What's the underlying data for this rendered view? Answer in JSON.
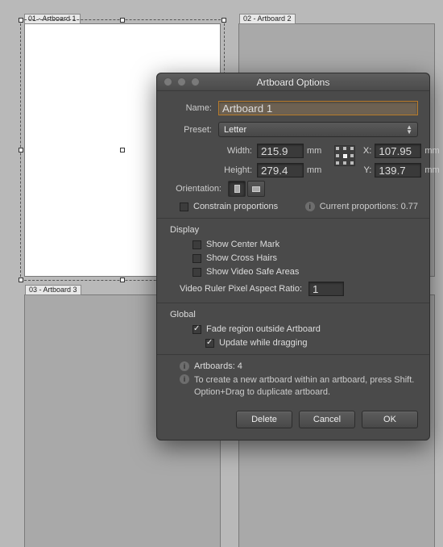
{
  "artboards": [
    {
      "label": "01 - Artboard 1"
    },
    {
      "label": "02 - Artboard 2"
    },
    {
      "label": "03 - Artboard 3"
    }
  ],
  "dialog": {
    "title": "Artboard Options",
    "name_label": "Name:",
    "name_value": "Artboard 1",
    "preset_label": "Preset:",
    "preset_value": "Letter",
    "width_label": "Width:",
    "width_value": "215.9",
    "width_unit": "mm",
    "height_label": "Height:",
    "height_value": "279.4",
    "height_unit": "mm",
    "x_label": "X:",
    "x_value": "107.95",
    "x_unit": "mm",
    "y_label": "Y:",
    "y_value": "139.7",
    "y_unit": "mm",
    "orientation_label": "Orientation:",
    "constrain_label": "Constrain proportions",
    "current_prop_label": "Current proportions: 0.77",
    "section_display": "Display",
    "show_center_mark": "Show Center Mark",
    "show_cross_hairs": "Show Cross Hairs",
    "show_video_safe": "Show Video Safe Areas",
    "video_aspect_label": "Video Ruler Pixel Aspect Ratio:",
    "video_aspect_value": "1",
    "section_global": "Global",
    "fade_region": "Fade region outside Artboard",
    "update_dragging": "Update while dragging",
    "artboards_count_label": "Artboards: 4",
    "help_text": "To create a new artboard within an artboard, press Shift. Option+Drag to duplicate artboard.",
    "buttons": {
      "delete": "Delete",
      "cancel": "Cancel",
      "ok": "OK"
    }
  }
}
